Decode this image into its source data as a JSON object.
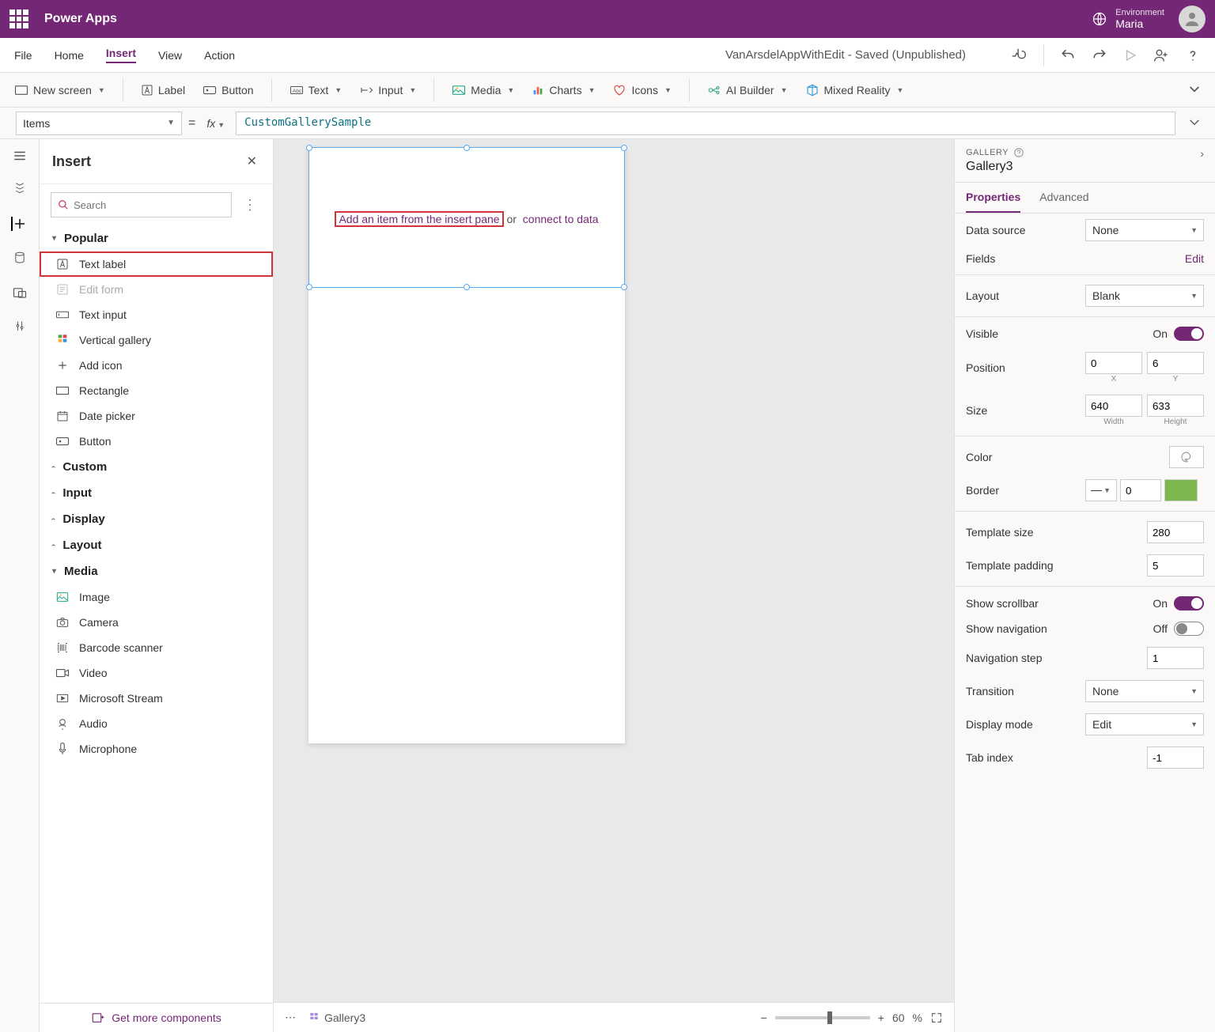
{
  "brand": "Power Apps",
  "environment": {
    "label": "Environment",
    "value": "Maria"
  },
  "menu": {
    "file": "File",
    "home": "Home",
    "insert": "Insert",
    "view": "View",
    "action": "Action"
  },
  "doc_title": "VanArsdelAppWithEdit - Saved (Unpublished)",
  "ribbon": {
    "new_screen": "New screen",
    "label": "Label",
    "button": "Button",
    "text": "Text",
    "input": "Input",
    "media": "Media",
    "charts": "Charts",
    "icons": "Icons",
    "ai": "AI Builder",
    "mr": "Mixed Reality"
  },
  "formula": {
    "prop": "Items",
    "value": "CustomGallerySample"
  },
  "insert_panel": {
    "title": "Insert",
    "search_placeholder": "Search",
    "grp_popular": "Popular",
    "items_popular": [
      "Text label",
      "Edit form",
      "Text input",
      "Vertical gallery",
      "Add icon",
      "Rectangle",
      "Date picker",
      "Button"
    ],
    "grp_custom": "Custom",
    "grp_input": "Input",
    "grp_display": "Display",
    "grp_layout": "Layout",
    "grp_media": "Media",
    "items_media": [
      "Image",
      "Camera",
      "Barcode scanner",
      "Video",
      "Microsoft Stream",
      "Audio",
      "Microphone"
    ],
    "footer": "Get more components"
  },
  "canvas": {
    "hint1": "Add an item from the insert pane",
    "hint_or": "or",
    "hint2": "connect to data"
  },
  "status": {
    "name": "Gallery3",
    "zoom": "60",
    "pct": "%"
  },
  "right": {
    "type": "GALLERY",
    "name": "Gallery3",
    "tab1": "Properties",
    "tab2": "Advanced",
    "data_source": "Data source",
    "data_source_v": "None",
    "fields": "Fields",
    "edit": "Edit",
    "layout": "Layout",
    "layout_v": "Blank",
    "visible": "Visible",
    "on": "On",
    "off": "Off",
    "position": "Position",
    "pos_x": "0",
    "pos_y": "6",
    "xl": "X",
    "yl": "Y",
    "size": "Size",
    "w": "640",
    "h": "633",
    "wl": "Width",
    "hl": "Height",
    "color": "Color",
    "border": "Border",
    "border_v": "0",
    "tpl_size": "Template size",
    "tpl_size_v": "280",
    "tpl_pad": "Template padding",
    "tpl_pad_v": "5",
    "scroll": "Show scrollbar",
    "nav": "Show navigation",
    "nav_step": "Navigation step",
    "nav_step_v": "1",
    "transition": "Transition",
    "transition_v": "None",
    "disp_mode": "Display mode",
    "disp_mode_v": "Edit",
    "tab_idx": "Tab index",
    "tab_idx_v": "-1"
  }
}
